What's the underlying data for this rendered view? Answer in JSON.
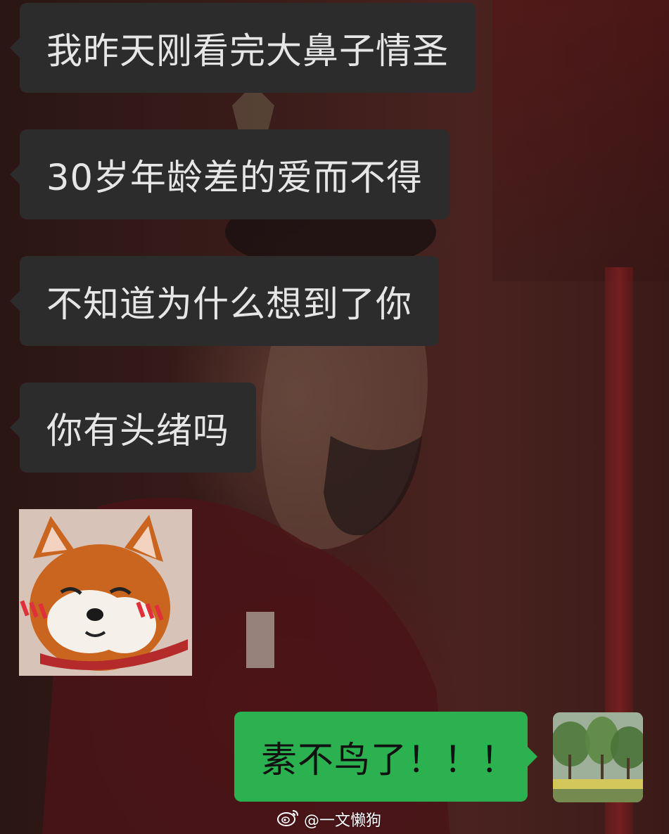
{
  "messages_incoming": [
    {
      "text": "我昨天刚看完大鼻子情圣"
    },
    {
      "text": "30岁年龄差的爱而不得"
    },
    {
      "text": "不知道为什么想到了你"
    },
    {
      "text": "你有头绪吗"
    }
  ],
  "sticker": {
    "icon": "shiba-dog-blushing-icon"
  },
  "message_outgoing": {
    "text": "素不鸟了！！！"
  },
  "avatar": {
    "icon": "landscape-painting-avatar"
  },
  "watermark": {
    "icon": "weibo-icon",
    "text": "@一文懒狗"
  },
  "colors": {
    "incoming_bubble": "#2c2c2c",
    "incoming_text": "#e6e6e6",
    "outgoing_bubble": "#2bb14f",
    "outgoing_text": "#111111"
  }
}
